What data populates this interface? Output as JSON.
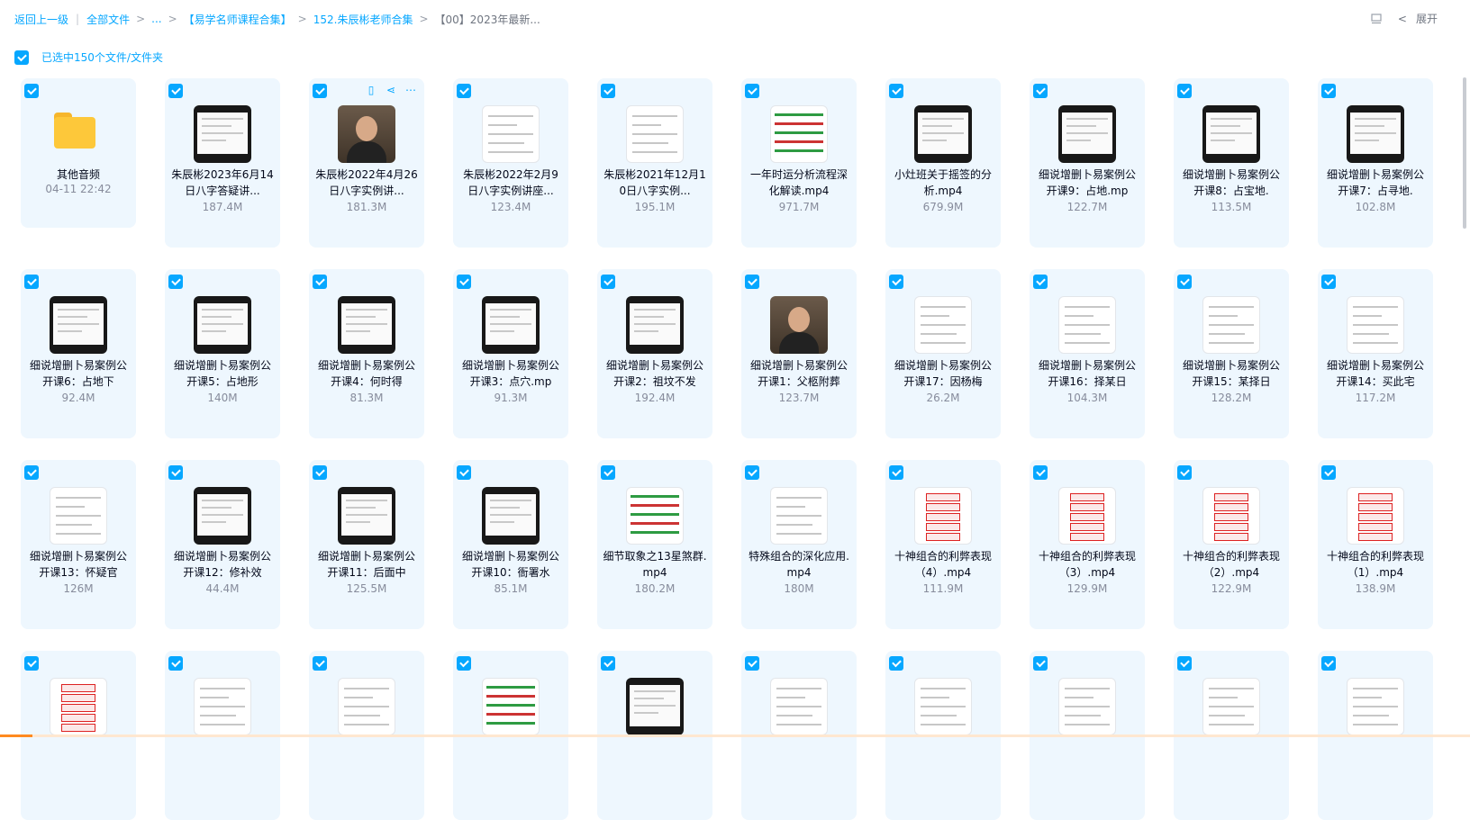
{
  "breadcrumb": {
    "back": "返回上一级",
    "all_files": "全部文件",
    "ellipsis": "...",
    "path": [
      "【易学名师课程合集】",
      "152.朱辰彬老师合集"
    ],
    "current": "【00】2023年最新..."
  },
  "right_controls": {
    "expand_label": "展开"
  },
  "selection": {
    "label": "已选中150个文件/文件夹"
  },
  "files": [
    {
      "name": "其他音频",
      "meta": "04-11 22:42",
      "kind": "folder"
    },
    {
      "name": "朱辰彬2023年6月14日八字答疑讲...",
      "meta": "187.4M",
      "kind": "video"
    },
    {
      "name": "朱辰彬2022年4月26日八字实例讲...",
      "meta": "181.3M",
      "kind": "person"
    },
    {
      "name": "朱辰彬2022年2月9日八字实例讲座...",
      "meta": "123.4M",
      "kind": "doc"
    },
    {
      "name": "朱辰彬2021年12月10日八字实例...",
      "meta": "195.1M",
      "kind": "doc"
    },
    {
      "name": "一年时运分析流程深化解读.mp4",
      "meta": "971.7M",
      "kind": "green"
    },
    {
      "name": "小灶班关于摇签的分析.mp4",
      "meta": "679.9M",
      "kind": "video"
    },
    {
      "name": "细说增删卜易案例公开课9：占地.mp",
      "meta": "122.7M",
      "kind": "video"
    },
    {
      "name": "细说增删卜易案例公开课8：占宝地.",
      "meta": "113.5M",
      "kind": "video"
    },
    {
      "name": "细说增删卜易案例公开课7：占寻地.",
      "meta": "102.8M",
      "kind": "video"
    },
    {
      "name": "细说增删卜易案例公开课6：占地下",
      "meta": "92.4M",
      "kind": "video"
    },
    {
      "name": "细说增删卜易案例公开课5：占地形",
      "meta": "140M",
      "kind": "video"
    },
    {
      "name": "细说增删卜易案例公开课4：何时得",
      "meta": "81.3M",
      "kind": "video"
    },
    {
      "name": "细说增删卜易案例公开课3：点穴.mp",
      "meta": "91.3M",
      "kind": "video"
    },
    {
      "name": "细说增删卜易案例公开课2：祖坟不发",
      "meta": "192.4M",
      "kind": "video"
    },
    {
      "name": "细说增删卜易案例公开课1：父柩附葬",
      "meta": "123.7M",
      "kind": "person"
    },
    {
      "name": "细说增删卜易案例公开课17：因杨梅",
      "meta": "26.2M",
      "kind": "doc"
    },
    {
      "name": "细说增删卜易案例公开课16：择某日",
      "meta": "104.3M",
      "kind": "doc"
    },
    {
      "name": "细说增删卜易案例公开课15：某择日",
      "meta": "128.2M",
      "kind": "doc"
    },
    {
      "name": "细说增删卜易案例公开课14：买此宅",
      "meta": "117.2M",
      "kind": "doc"
    },
    {
      "name": "细说增删卜易案例公开课13：怀疑官",
      "meta": "126M",
      "kind": "doc"
    },
    {
      "name": "细说增删卜易案例公开课12：修补效",
      "meta": "44.4M",
      "kind": "video"
    },
    {
      "name": "细说增删卜易案例公开课11：后面中",
      "meta": "125.5M",
      "kind": "video"
    },
    {
      "name": "细说增删卜易案例公开课10：衙署水",
      "meta": "85.1M",
      "kind": "video"
    },
    {
      "name": "细节取象之13星煞群.mp4",
      "meta": "180.2M",
      "kind": "green"
    },
    {
      "name": "特殊组合的深化应用.mp4",
      "meta": "180M",
      "kind": "doc"
    },
    {
      "name": "十神组合的利弊表现（4）.mp4",
      "meta": "111.9M",
      "kind": "red"
    },
    {
      "name": "十神组合的利弊表现（3）.mp4",
      "meta": "129.9M",
      "kind": "red"
    },
    {
      "name": "十神组合的利弊表现（2）.mp4",
      "meta": "122.9M",
      "kind": "red"
    },
    {
      "name": "十神组合的利弊表现（1）.mp4",
      "meta": "138.9M",
      "kind": "red"
    },
    {
      "name": "",
      "meta": "",
      "kind": "red"
    },
    {
      "name": "",
      "meta": "",
      "kind": "doc"
    },
    {
      "name": "",
      "meta": "",
      "kind": "doc"
    },
    {
      "name": "",
      "meta": "",
      "kind": "green"
    },
    {
      "name": "",
      "meta": "",
      "kind": "video"
    },
    {
      "name": "",
      "meta": "",
      "kind": "doc"
    },
    {
      "name": "",
      "meta": "",
      "kind": "doc"
    },
    {
      "name": "",
      "meta": "",
      "kind": "doc"
    },
    {
      "name": "",
      "meta": "",
      "kind": "doc"
    },
    {
      "name": "",
      "meta": "",
      "kind": "doc"
    }
  ],
  "colors": {
    "accent": "#06a7ff",
    "card_bg": "#eef7fe",
    "folder": "#fdc83a"
  }
}
